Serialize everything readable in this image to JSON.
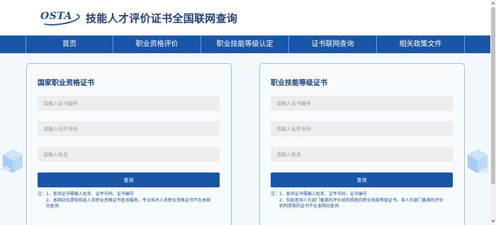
{
  "header": {
    "logo_text": "OSTA",
    "title": "技能人才评价证书全国联网查询"
  },
  "nav": {
    "items": [
      {
        "label": "首页"
      },
      {
        "label": "职业资格评价"
      },
      {
        "label": "职业技能等级认定"
      },
      {
        "label": "证书联网查询"
      },
      {
        "label": "相关政策文件"
      }
    ]
  },
  "cards": {
    "left": {
      "title": "国家职业资格证书",
      "cert_no_placeholder": "请输入证书编号",
      "id_no_placeholder": "请输入证件号码",
      "name_placeholder": "请输入姓名",
      "button": "查询",
      "note_1": "注：1、查询证书需输入姓名、证件号码、证书编号",
      "note_2a": "2、本网站仅提供技能人员职业资格证书查询服务，专业技术人员职业资格证书不在本网",
      "note_2b": "站查询"
    },
    "right": {
      "title": "职业技能等级证书",
      "cert_no_placeholder": "请输入证书编号",
      "id_no_placeholder": "请输入证件号码",
      "name_placeholder": "请输入姓名",
      "button": "查询",
      "note_1": "注：1、查询证书需输入姓名、证件号码、证书编号",
      "note_2a": "2、仅能查询人社部门备案的评价机构颁发的职业技能等级证书，非人社部门备案的评价",
      "note_2b": "机构颁发的证书不在本网站查询"
    }
  },
  "colors": {
    "brand": "#1a56a8",
    "title": "#1f3f78",
    "card_border": "#9fc0e6",
    "page_bg": "#f3f8fd"
  }
}
